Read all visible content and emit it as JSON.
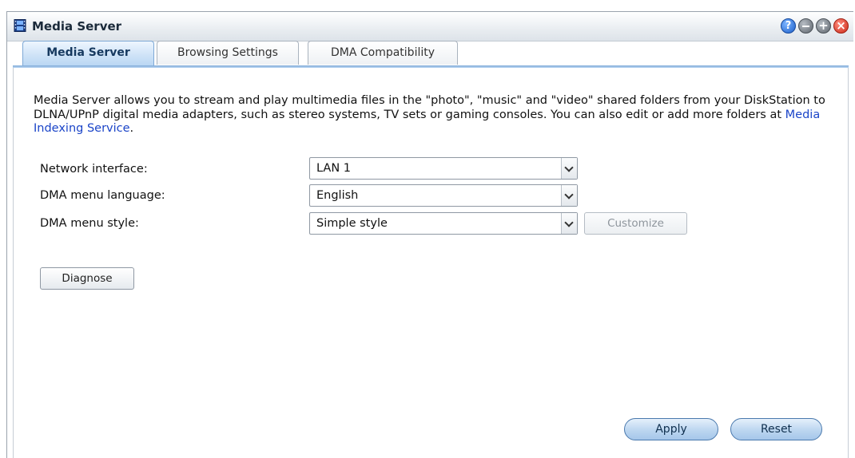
{
  "window": {
    "title": "Media Server",
    "controls": [
      "help-icon",
      "minimize-icon",
      "maximize-icon",
      "close-icon"
    ]
  },
  "tabs": [
    {
      "label": "Media Server",
      "active": true
    },
    {
      "label": "Browsing Settings",
      "active": false
    },
    {
      "label": "DMA Compatibility",
      "active": false
    }
  ],
  "description": {
    "text": "Media Server allows you to stream and play multimedia files in the \"photo\", \"music\" and \"video\" shared folders from your DiskStation to DLNA/UPnP digital media adapters, such as stereo systems, TV sets or gaming consoles. You can also edit or add more folders at ",
    "link": "Media Indexing Service",
    "suffix": "."
  },
  "form": {
    "network_interface": {
      "label": "Network interface:",
      "value": "LAN 1"
    },
    "dma_menu_language": {
      "label": "DMA menu language:",
      "value": "English"
    },
    "dma_menu_style": {
      "label": "DMA menu style:",
      "value": "Simple style",
      "customize_label": "Customize"
    }
  },
  "buttons": {
    "diagnose": "Diagnose",
    "apply": "Apply",
    "reset": "Reset"
  },
  "colors": {
    "accent": "#7ea9d6",
    "link": "#1a44c8"
  }
}
